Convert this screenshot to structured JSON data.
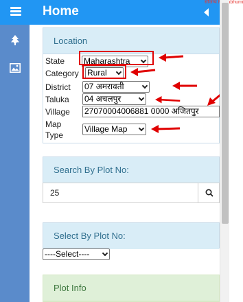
{
  "header": {
    "title": "Home",
    "corner_text": "सौजन्य Mahabhumi"
  },
  "sidebar": {
    "icons": [
      "tree-icon",
      "image-icon"
    ]
  },
  "location": {
    "title": "Location",
    "state_label": "State",
    "state_value": "Maharashtra",
    "category_label": "Category",
    "category_value": "Rural",
    "district_label": "District",
    "district_value": "07 अमरावती",
    "taluka_label": "Taluka",
    "taluka_value": "04 अचलपुर",
    "village_label": "Village",
    "village_value": "27070004006881 0000 अजितपुर",
    "maptype_label_1": "Map",
    "maptype_label_2": "Type",
    "maptype_value": "Village Map"
  },
  "search_plot": {
    "title": "Search By Plot No:",
    "value": "25"
  },
  "select_plot": {
    "title": "Select By Plot No:",
    "value": "----Select----"
  },
  "plot_info": {
    "title": "Plot Info"
  },
  "colors": {
    "header": "#2196f3",
    "sidebar": "#5a8bcb",
    "panel_head": "#d9edf7",
    "annotation": "#e00000"
  }
}
